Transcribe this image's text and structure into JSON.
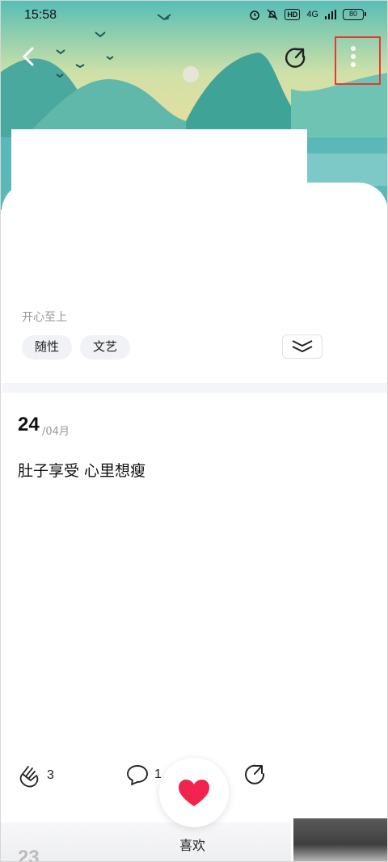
{
  "status_bar": {
    "time": "15:58",
    "hd": "HD",
    "network": "4G",
    "battery": "80"
  },
  "header": {
    "back_icon": "chevron-left-icon",
    "share_icon": "share-arrow-icon",
    "more_icon": "more-vertical-icon",
    "highlight_color": "#e53935"
  },
  "notebook": {
    "subtitle": "开心至上",
    "tags": [
      "随性",
      "文艺"
    ],
    "expand_icon": "double-chevron-down-icon"
  },
  "entry": {
    "day": "24",
    "month": "/04月",
    "text": "肚子享受 心里想瘦"
  },
  "actions": {
    "clap_count": "3",
    "comment_count": "1",
    "like_label": "喜欢",
    "like_color": "#f0244f"
  },
  "next_entry": {
    "day": "23"
  }
}
